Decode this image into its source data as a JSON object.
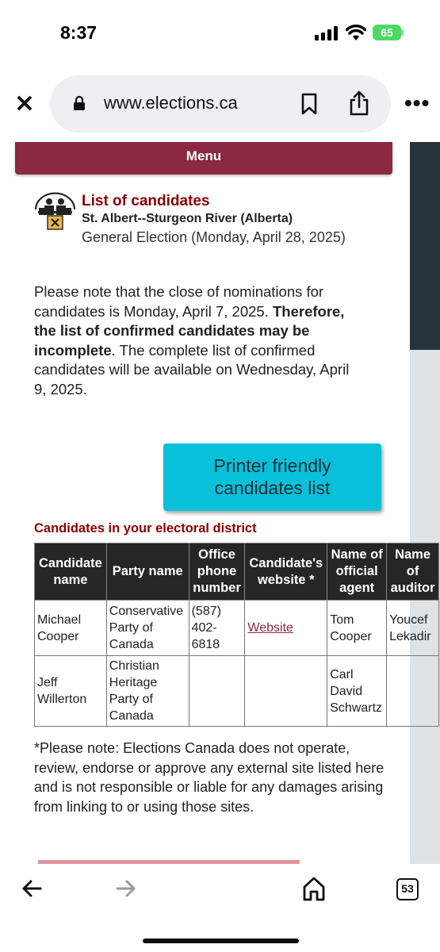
{
  "status_bar": {
    "time": "8:37",
    "battery": "65"
  },
  "browser": {
    "url": "www.elections.ca"
  },
  "menu": {
    "label": "Menu"
  },
  "header": {
    "title": "List of candidates",
    "district": "St. Albert--Sturgeon River (Alberta)",
    "election": "General Election (Monday, April 28, 2025)"
  },
  "notice": {
    "part1": "Please note that the close of nominations for candidates is Monday, April 7, 2025. ",
    "bold": "Therefore, the list of confirmed candidates may be incomplete",
    "part2": ". The complete list of confirmed candidates will be available on Wednesday, April 9, 2025."
  },
  "printer_button": {
    "line1": "Printer friendly",
    "line2": "candidates list"
  },
  "section_title": "Candidates in your electoral district",
  "table": {
    "headers": {
      "candidate": [
        "Candidate",
        "name"
      ],
      "party": [
        "Party name"
      ],
      "phone": [
        "Office",
        "phone",
        "number"
      ],
      "website": [
        "Candidate's",
        "website *"
      ],
      "agent": [
        "Name of",
        "official",
        "agent"
      ],
      "auditor": [
        "Name",
        "of",
        "auditor"
      ]
    },
    "rows": [
      {
        "candidate": [
          "Michael",
          "Cooper"
        ],
        "party": [
          "Conservative",
          "Party of",
          "Canada"
        ],
        "phone": [
          "(587)",
          "402-",
          "6818"
        ],
        "website": "Website",
        "agent": [
          "Tom",
          "Cooper"
        ],
        "auditor": [
          "Youcef",
          "Lekadir"
        ]
      },
      {
        "candidate": [
          "Jeff",
          "Willerton"
        ],
        "party": [
          "Christian",
          "Heritage",
          "Party of",
          "Canada"
        ],
        "phone": [],
        "website": "",
        "agent": [
          "Carl",
          "David",
          "Schwartz"
        ],
        "auditor": []
      }
    ]
  },
  "disclaimer": "*Please note: Elections Canada does not operate, review, endorse or approve any external site listed here and is not responsible or liable for any damages arising from linking to or using those sites.",
  "toolbar": {
    "tab_count": "53"
  },
  "colors": {
    "menu": "#8b2941",
    "title": "#8b0000",
    "button": "#08c0da",
    "table_header": "#262626"
  }
}
